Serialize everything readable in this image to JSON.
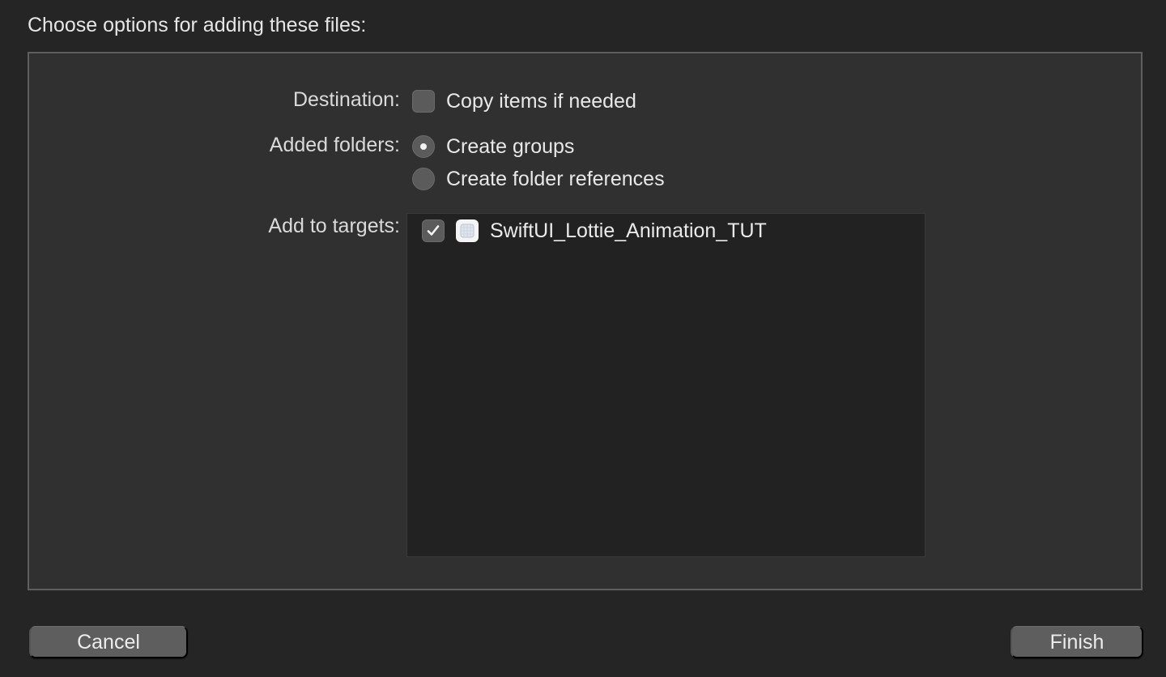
{
  "dialog": {
    "heading": "Choose options for adding these files:"
  },
  "destination": {
    "label": "Destination:",
    "copy_items": {
      "label": "Copy items if needed",
      "checked": false
    }
  },
  "added_folders": {
    "label": "Added folders:",
    "options": [
      {
        "label": "Create groups",
        "selected": true
      },
      {
        "label": "Create folder references",
        "selected": false
      }
    ]
  },
  "targets": {
    "label": "Add to targets:",
    "items": [
      {
        "name": "SwiftUI_Lottie_Animation_TUT",
        "checked": true,
        "icon": "app-target-icon"
      }
    ]
  },
  "buttons": {
    "cancel": "Cancel",
    "finish": "Finish"
  }
}
